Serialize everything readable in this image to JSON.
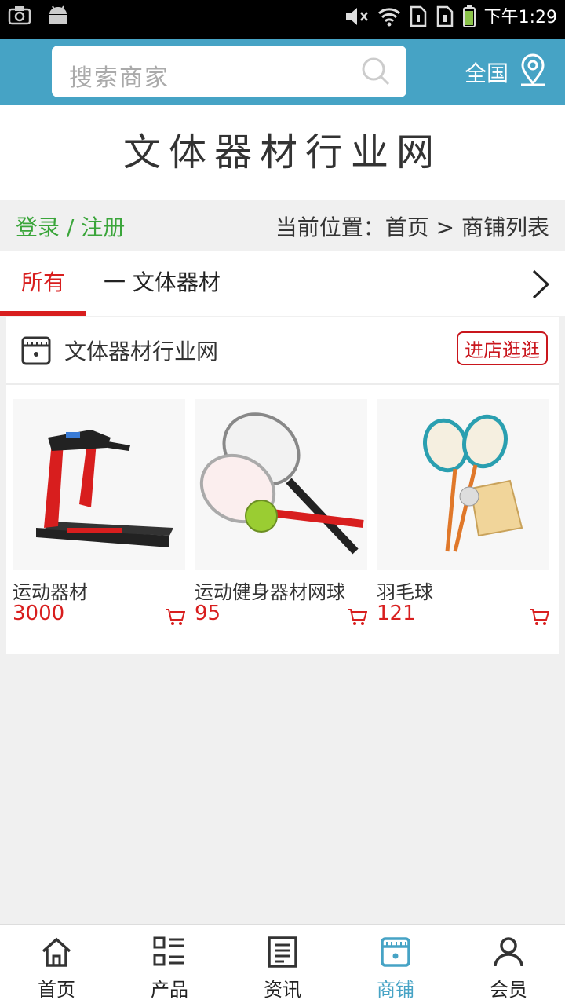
{
  "status_bar": {
    "time": "下午1:29"
  },
  "header": {
    "search_placeholder": "搜索商家",
    "region": "全国"
  },
  "site_title": "文体器材行业网",
  "crumb": {
    "login": "登录 / 注册",
    "location": "当前位置：首页 > 商铺列表"
  },
  "tabs": {
    "all": "所有",
    "category": "一 文体器材"
  },
  "shop": {
    "name": "文体器材行业网",
    "enter_label": "进店逛逛",
    "products": [
      {
        "name": "运动器材",
        "price": "3000",
        "icon": "treadmill"
      },
      {
        "name": "运动健身器材网球",
        "price": "95",
        "icon": "tennis-rackets"
      },
      {
        "name": "羽毛球",
        "price": "121",
        "icon": "badminton"
      }
    ]
  },
  "bottom_nav": [
    {
      "label": "首页",
      "icon": "home-icon"
    },
    {
      "label": "产品",
      "icon": "list-icon"
    },
    {
      "label": "资讯",
      "icon": "news-icon"
    },
    {
      "label": "商铺",
      "icon": "shop-icon",
      "active": true
    },
    {
      "label": "会员",
      "icon": "user-icon"
    }
  ],
  "colors": {
    "header": "#46a3c5",
    "accent": "#d81e1e",
    "login_green": "#3aa53a"
  }
}
